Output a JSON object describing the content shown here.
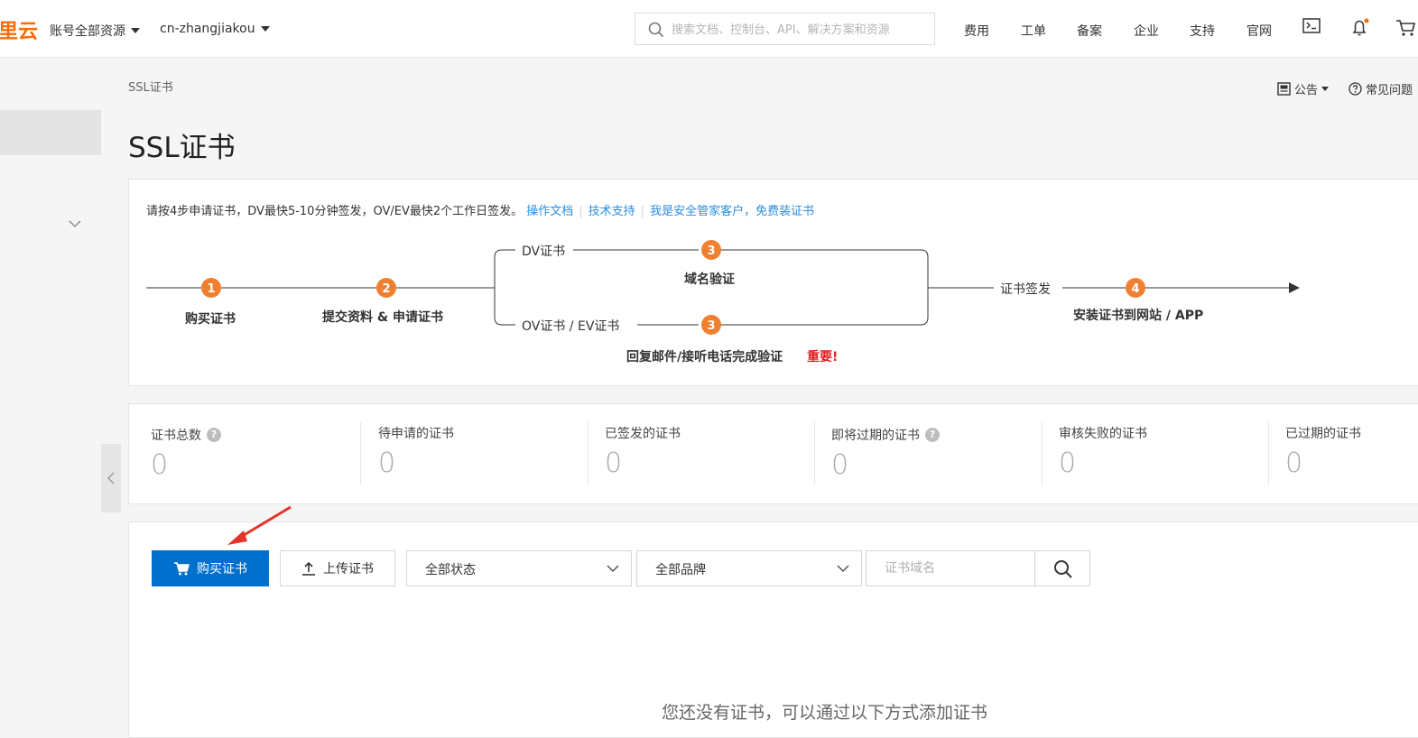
{
  "topbar": {
    "logo_fragment": "里云",
    "account_scope": "账号全部资源",
    "region": "cn-zhangjiakou",
    "search_placeholder": "搜索文档、控制台、API、解决方案和资源",
    "nav": [
      "费用",
      "工单",
      "备案",
      "企业",
      "支持",
      "官网"
    ],
    "icons": [
      "terminal-icon",
      "bell-icon",
      "cart-icon"
    ],
    "notification_dot_color": "#ff6a00"
  },
  "page": {
    "breadcrumb": "SSL证书",
    "title": "SSL证书",
    "announcement_label": "公告",
    "faq_label": "常见问题"
  },
  "steps": {
    "intro": "请按4步申请证书，DV最快5-10分钟签发，OV/EV最快2个工作日签发。",
    "links": [
      "操作文档",
      "技术支持",
      "我是安全管家客户，免费装证书"
    ],
    "step1": "购买证书",
    "step2": "提交资料 & 申请证书",
    "dv_label": "DV证书",
    "dv_step": "域名验证",
    "ov_label": "OV证书 / EV证书",
    "ov_step": "回复邮件/接听电话完成验证",
    "important": "重要!",
    "issue_label": "证书签发",
    "step4": "安装证书到网站 / APP",
    "numbers": [
      "1",
      "2",
      "3",
      "3",
      "4"
    ],
    "accent_color": "#f0802f"
  },
  "stats": [
    {
      "label": "证书总数",
      "value": "0",
      "help": true
    },
    {
      "label": "待申请的证书",
      "value": "0",
      "help": false
    },
    {
      "label": "已签发的证书",
      "value": "0",
      "help": false
    },
    {
      "label": "即将过期的证书",
      "value": "0",
      "help": true
    },
    {
      "label": "审核失败的证书",
      "value": "0",
      "help": false
    },
    {
      "label": "已过期的证书",
      "value": "0",
      "help": false
    }
  ],
  "stats_help_glyph": "?",
  "toolbar": {
    "buy_label": "购买证书",
    "upload_label": "上传证书",
    "status_select": "全部状态",
    "brand_select": "全部品牌",
    "domain_placeholder": "证书域名",
    "primary_color": "#0070cc"
  },
  "empty": {
    "message": "您还没有证书，可以通过以下方式添加证书"
  }
}
